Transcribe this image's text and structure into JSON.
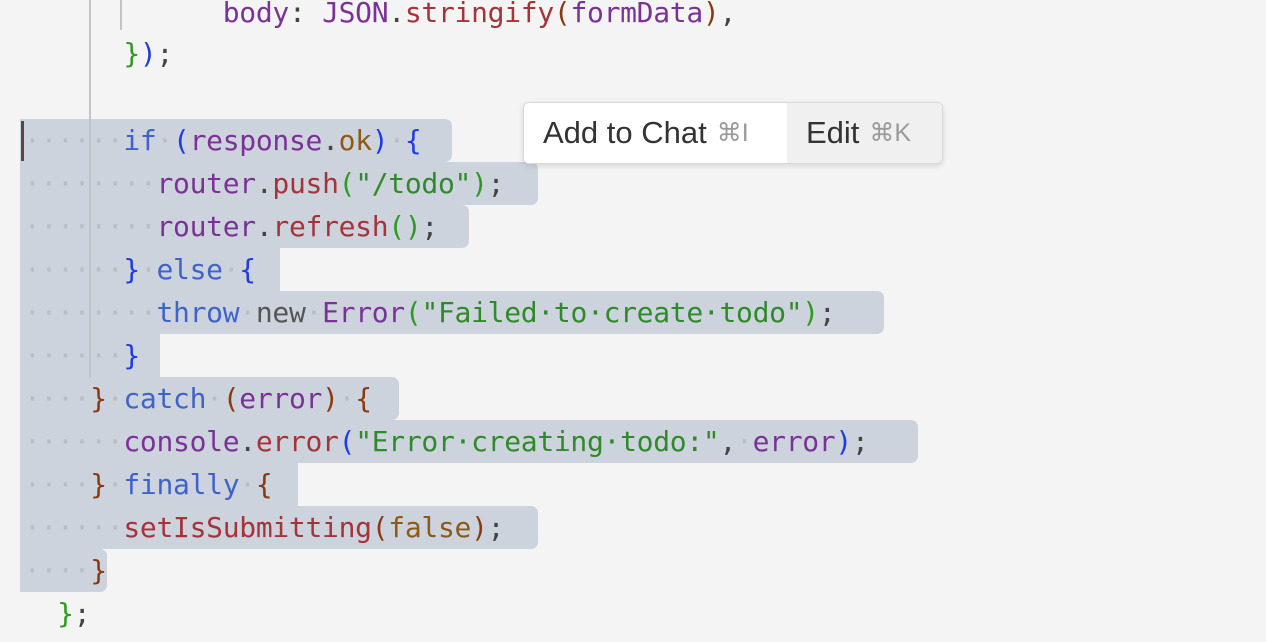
{
  "popup": {
    "add_label": "Add to Chat",
    "add_shortcut": "⌘I",
    "edit_label": "Edit",
    "edit_shortcut": "⌘K"
  },
  "code": {
    "l0_a": "body",
    "l0_b": ":",
    "l0_c": "JSON",
    "l0_d": ".",
    "l0_e": "stringify",
    "l0_f": "(",
    "l0_g": "formData",
    "l0_h": ")",
    "l0_i": ",",
    "l1_a": "}",
    "l1_b": ")",
    "l1_c": ";",
    "l3_if": "if",
    "l3_p1": "(",
    "l3_resp": "response",
    "l3_dot": ".",
    "l3_ok": "ok",
    "l3_p2": ")",
    "l3_br": "{",
    "l4_router": "router",
    "l4_dot": ".",
    "l4_push": "push",
    "l4_p1": "(",
    "l4_str": "\"/todo\"",
    "l4_p2": ")",
    "l4_semi": ";",
    "l5_router": "router",
    "l5_dot": ".",
    "l5_refresh": "refresh",
    "l5_p": "()",
    "l5_semi": ";",
    "l6_br": "}",
    "l6_else": "else",
    "l6_br2": "{",
    "l7_throw": "throw",
    "l7_new": "new",
    "l7_err": "Error",
    "l7_p1": "(",
    "l7_str": "\"Failed·to·create·todo\"",
    "l7_p2": ")",
    "l7_semi": ";",
    "l8_br": "}",
    "l9_br": "}",
    "l9_catch": "catch",
    "l9_p1": "(",
    "l9_error": "error",
    "l9_p2": ")",
    "l9_br2": "{",
    "l10_console": "console",
    "l10_dot": ".",
    "l10_error": "error",
    "l10_p1": "(",
    "l10_str": "\"Error·creating·todo:\"",
    "l10_comma": ",",
    "l10_errv": "error",
    "l10_p2": ")",
    "l10_semi": ";",
    "l11_br": "}",
    "l11_finally": "finally",
    "l11_br2": "{",
    "l12_fn": "setIsSubmitting",
    "l12_p1": "(",
    "l12_false": "false",
    "l12_p2": ")",
    "l12_semi": ";",
    "l13_br": "}",
    "l14_br": "}",
    "l14_semi": ";"
  }
}
